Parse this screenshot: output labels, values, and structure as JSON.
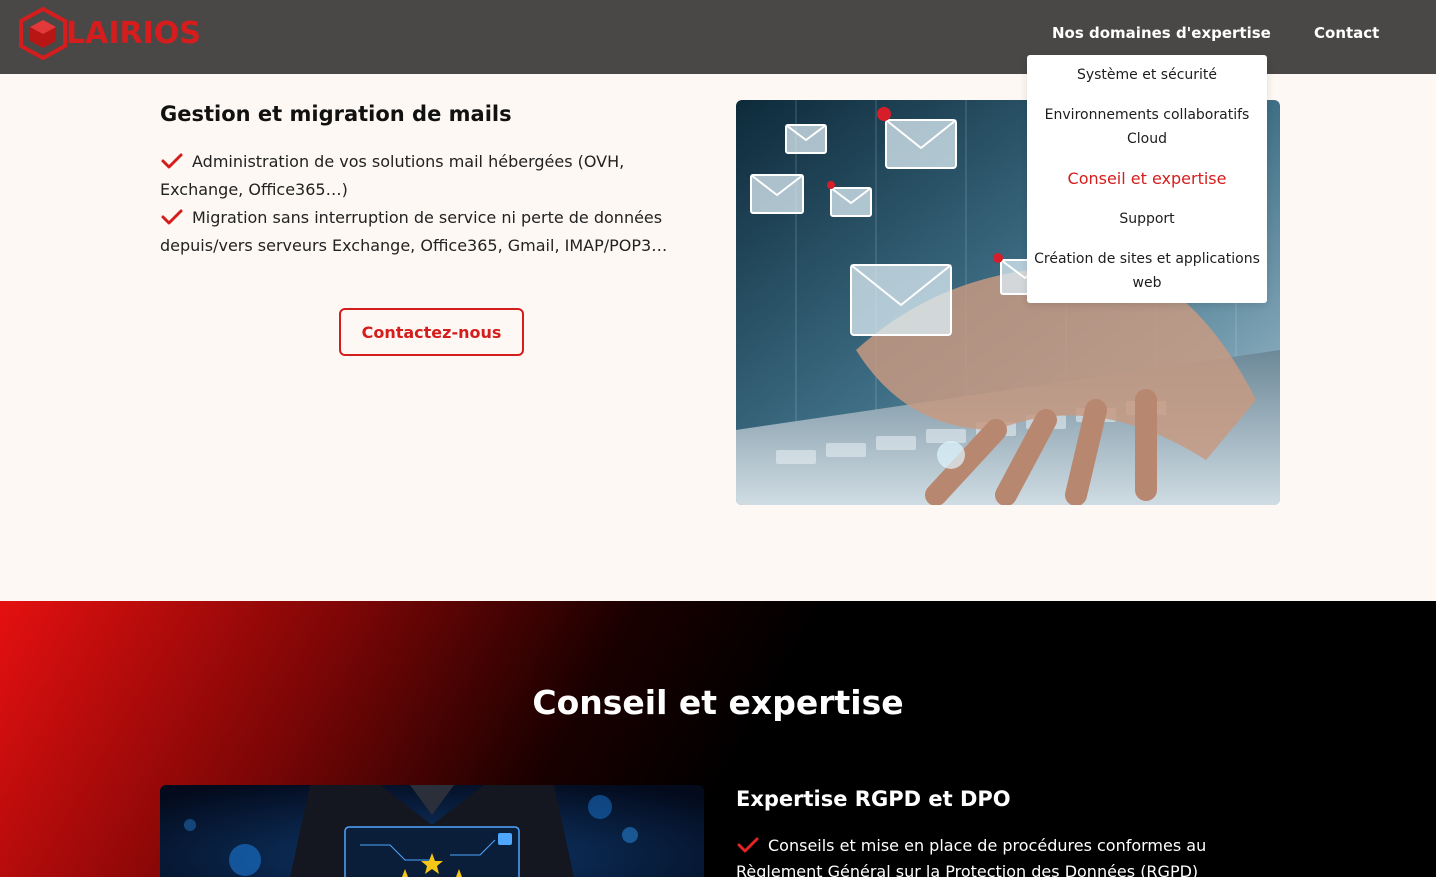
{
  "header": {
    "logo_text": "LAIRIOS",
    "nav": {
      "expertise": "Nos domaines d'expertise",
      "contact": "Contact"
    }
  },
  "dropdown": {
    "items": [
      "Système et sécurité",
      "Environnements collaboratifs Cloud",
      "Conseil et expertise",
      "Support",
      "Création de sites et applications web"
    ],
    "active_index": 2
  },
  "mail_section": {
    "title": "Gestion et migration de mails",
    "bullets": [
      "Administration de vos solutions mail hébergées (OVH, Exchange, Office365…)",
      "Migration sans interruption de service ni perte de données depuis/vers serveurs Exchange, Office365, Gmail, IMAP/POP3…"
    ],
    "button_label": "Contactez-nous"
  },
  "conseil_section": {
    "title": "Conseil et expertise",
    "subtitle": "Expertise RGPD et DPO",
    "bullet": "Conseils et mise en place de procédures conformes au Règlement Général sur la Protection des Données (RGPD)"
  },
  "colors": {
    "brand_red": "#d51d1d",
    "header_bg": "#4a4846",
    "page_bg": "#fdf8f3"
  }
}
